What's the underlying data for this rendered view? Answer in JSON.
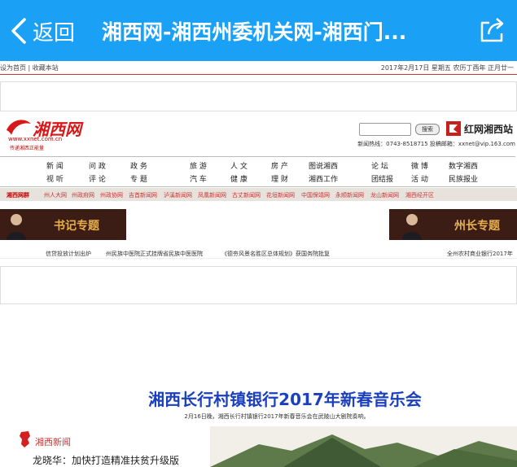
{
  "navbar": {
    "back_label": "返回",
    "title": "湘西网-湘西州委机关网-湘西门...",
    "accent": "#1aa1f5"
  },
  "top_strip": {
    "left": "设为首页 | 收藏本站",
    "right": "2017年2月17日 星期五 农历丁酉年 正月廿一"
  },
  "header": {
    "logo_text": "湘西网",
    "logo_url": "www.xxnet.com.cn",
    "logo_slogan": "传递湘西正能量",
    "search_button": "搜索",
    "hong_label": "红网湘西站",
    "hotline": "新闻热线：0743-8518715 投稿邮箱：xxnet@vip.163.com"
  },
  "main_nav": {
    "row1": [
      "新 闻",
      "问 政",
      "政 务",
      "旅 游",
      "人 文",
      "房 产",
      "图说湘西",
      "论 坛",
      "微 博",
      "数字湘西"
    ],
    "row2": [
      "视 听",
      "评 论",
      "专 题",
      "汽 车",
      "健 康",
      "理 财",
      "湘西工作",
      "团结报",
      "活 动",
      "民族报业"
    ]
  },
  "sub_nav": {
    "group": "湘西网群",
    "sites": [
      "州人大网",
      "州政府网",
      "州政协网",
      "吉首新闻网",
      "泸溪新闻网",
      "凤凰新闻网",
      "古丈新闻网",
      "花垣新闻网",
      "中国保靖网",
      "永顺新闻网",
      "龙山新闻网",
      "湘西经开区"
    ]
  },
  "banners": {
    "left": "书记专题",
    "right": "州长专题"
  },
  "ticker": [
    "信贷投放计划出炉",
    "州民族中医院正式挂牌省民族中医医院",
    "《德夯风景名胜区总体规划》获国务院批复",
    "全州农村商业银行2017年"
  ],
  "article": {
    "title": "湘西长行村镇银行2017年新春音乐会",
    "caption": "2月16日晚，湘西长行村镇银行2017年新春音乐会在武陵山大剧院奏响。",
    "section": "湘西新闻",
    "headline": "龙晓华：加快打造精准扶贫升级版"
  }
}
